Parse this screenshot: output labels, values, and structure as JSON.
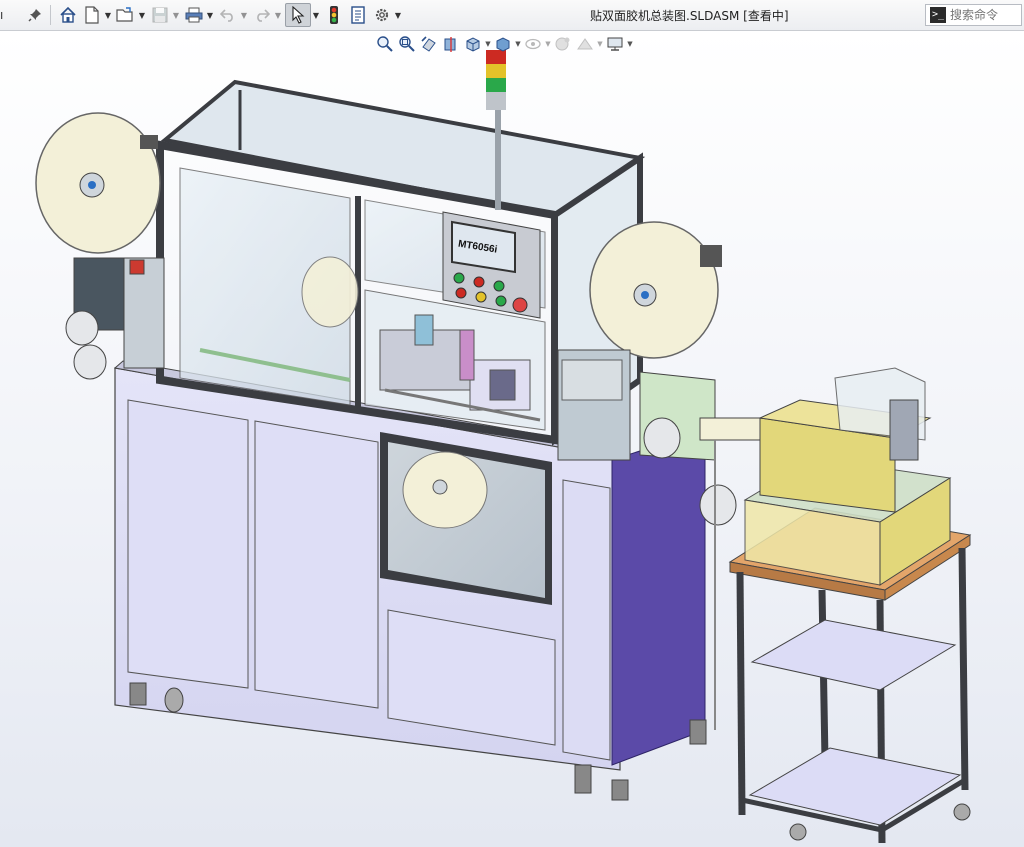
{
  "window": {
    "title": "贴双面胶机总装图.SLDASM [查看中]"
  },
  "toolbar": {
    "items": [
      {
        "name": "help-arrow",
        "glyph": "ı"
      },
      {
        "name": "pin",
        "glyph": "📌"
      },
      {
        "name": "home"
      },
      {
        "name": "new"
      },
      {
        "name": "open"
      },
      {
        "name": "save"
      },
      {
        "name": "print"
      },
      {
        "name": "undo"
      },
      {
        "name": "redo"
      },
      {
        "name": "select"
      },
      {
        "name": "traffic-light"
      },
      {
        "name": "file-properties"
      },
      {
        "name": "options"
      }
    ]
  },
  "search": {
    "placeholder": "搜索命令"
  },
  "hmi": {
    "label": "MT6056i"
  },
  "colors": {
    "frame": "#3b3d42",
    "panel": "#dcdcf4",
    "tabletop": "#e3a56a",
    "yellow_box": "#e2d77a",
    "blue_panel": "#5b4aa8",
    "reel": "#f3f0d8",
    "glass": "#d9e6ef"
  }
}
